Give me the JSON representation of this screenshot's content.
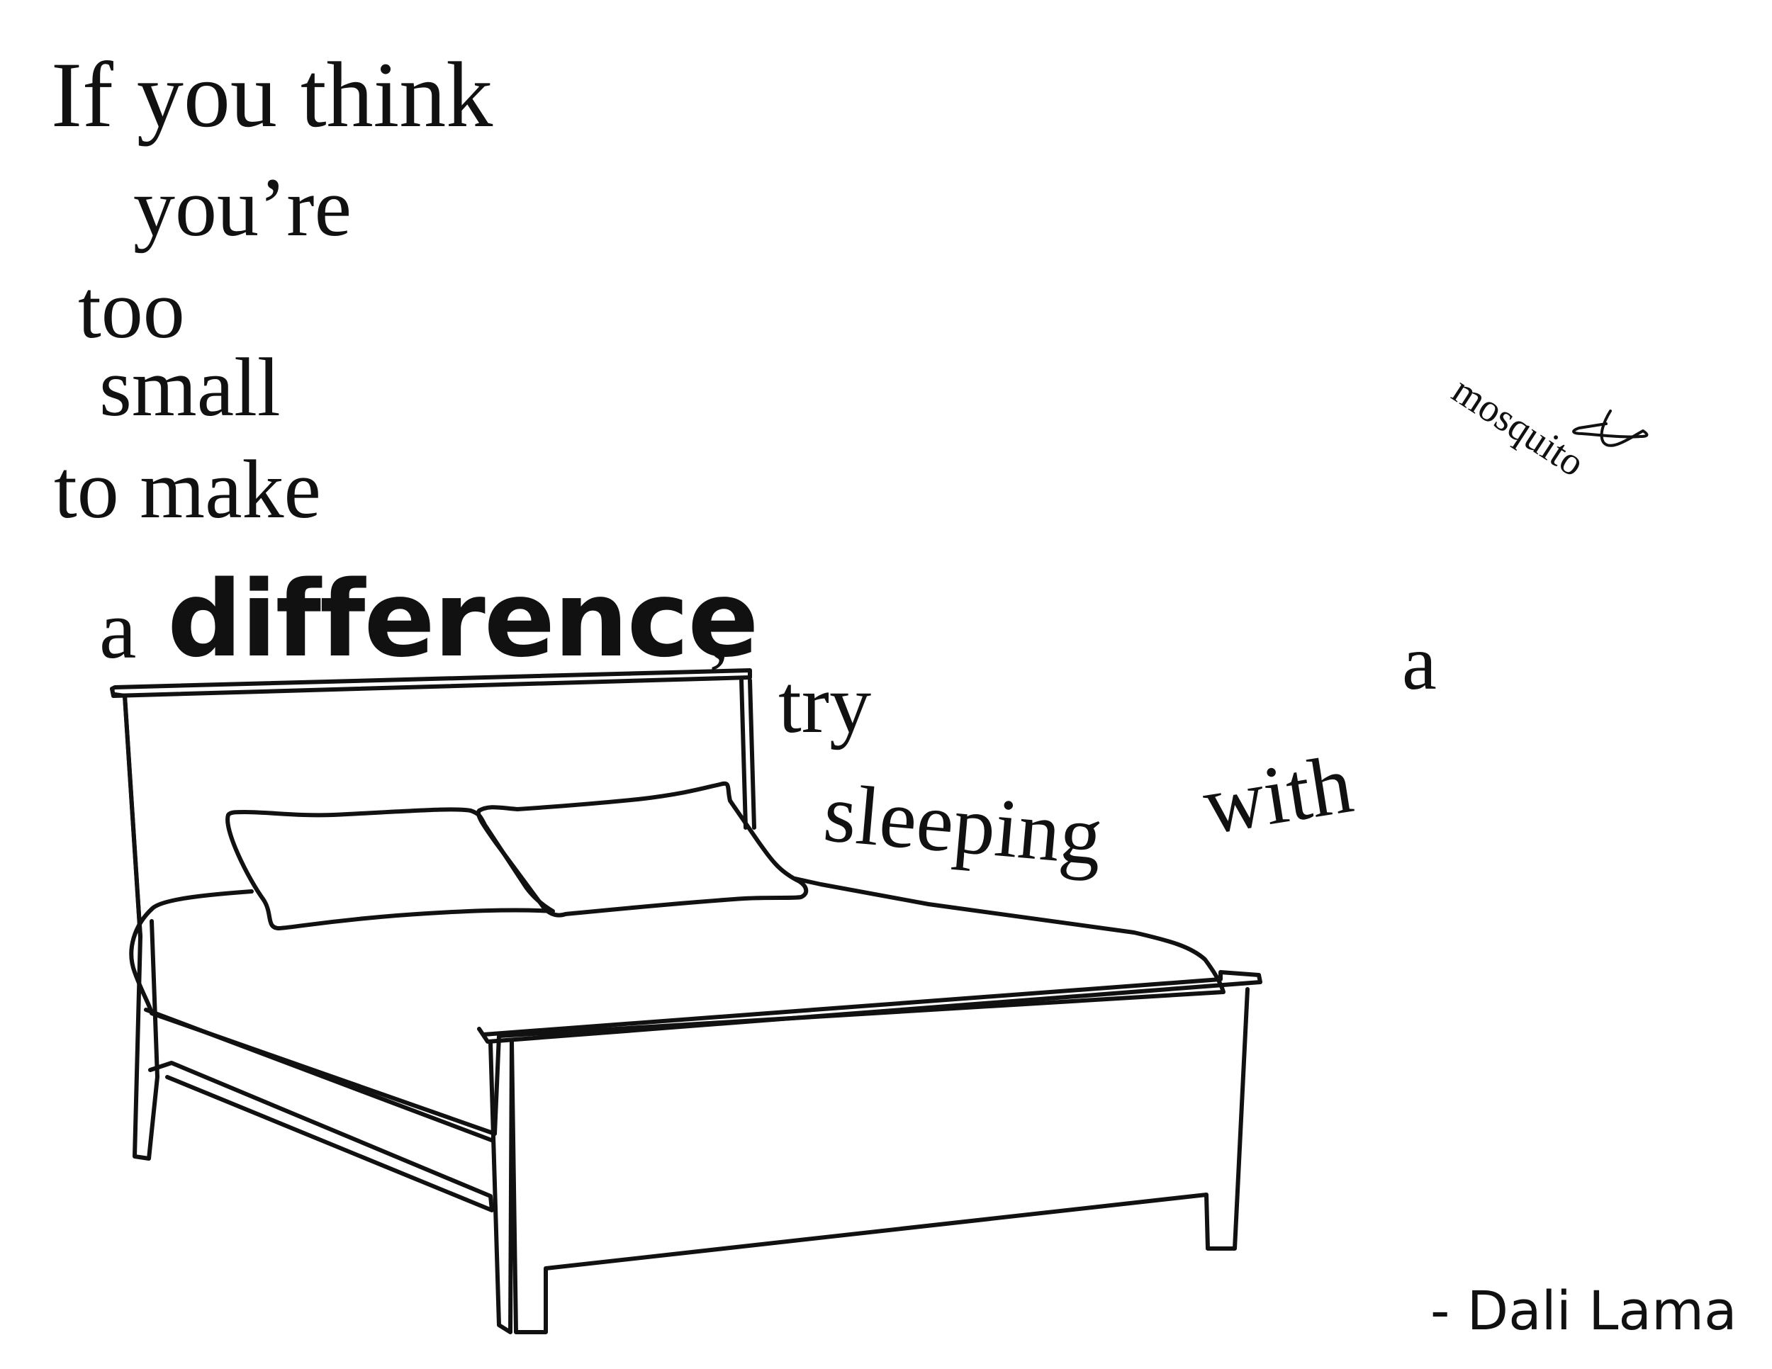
{
  "quote": {
    "line1": "If you think",
    "line2": "you’re",
    "line3": "too",
    "line4": "small",
    "line5": "to make",
    "word_a": "a",
    "word_difference": "difference",
    "comma": ",",
    "word_try": "try",
    "word_sleeping": "sleeping",
    "word_with": "with",
    "word_a2": "a",
    "word_mosquito": "mosquito"
  },
  "attribution": "- Dali Lama",
  "icons": [
    "bed-illustration",
    "mosquito-icon"
  ],
  "colors": {
    "ink": "#111111",
    "background": "#ffffff"
  }
}
